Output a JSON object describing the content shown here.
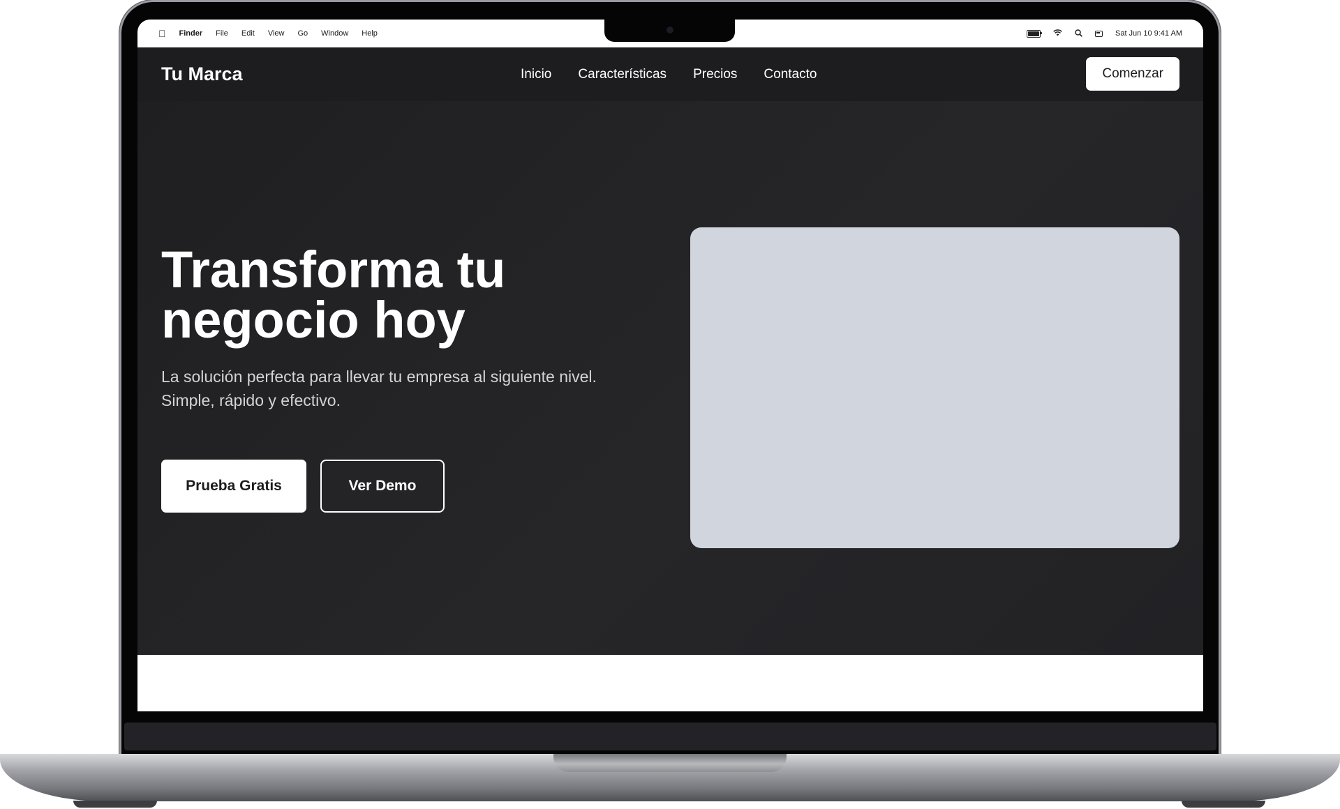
{
  "menubar": {
    "app_name": "Finder",
    "menus": [
      "File",
      "Edit",
      "View",
      "Go",
      "Window",
      "Help"
    ],
    "datetime": "Sat Jun 10  9:41 AM",
    "icons": [
      "apple-icon",
      "battery-icon",
      "wifi-icon",
      "search-icon",
      "control-center-icon"
    ]
  },
  "site": {
    "brand": "Tu Marca",
    "nav": [
      "Inicio",
      "Características",
      "Precios",
      "Contacto"
    ],
    "cta_label": "Comenzar"
  },
  "hero": {
    "title": "Transforma tu negocio hoy",
    "subtitle": "La solución perfecta para llevar tu empresa al siguiente nivel. Simple, rápido y efectivo.",
    "primary_button": "Prueba Gratis",
    "secondary_button": "Ver Demo"
  },
  "colors": {
    "hero_background": "#222225",
    "image_placeholder": "#d1d5de",
    "button_primary_bg": "#ffffff",
    "text_on_dark": "#ffffff"
  }
}
